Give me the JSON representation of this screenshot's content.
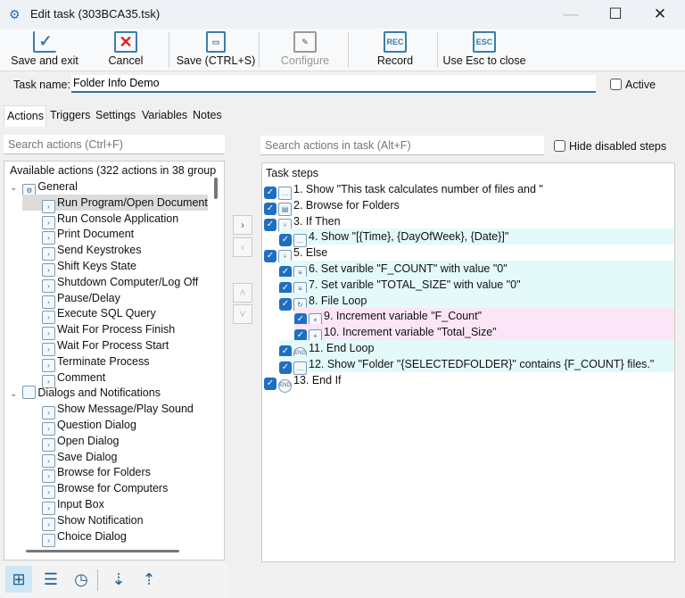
{
  "window": {
    "title": "Edit task (303BCA35.tsk)",
    "minimize": "—",
    "maximize": "☐",
    "close": "✕"
  },
  "toolbar": {
    "save_exit": "Save and exit",
    "cancel": "Cancel",
    "save": "Save (CTRL+S)",
    "configure": "Configure",
    "record": "Record",
    "esc": "Use Esc to close",
    "rec_icon": "REC",
    "esc_icon": "ESC"
  },
  "task_name": {
    "label": "Task name:",
    "value": "Folder Info Demo",
    "active_label": "Active"
  },
  "tabs": [
    "Actions",
    "Triggers",
    "Settings",
    "Variables",
    "Notes"
  ],
  "left": {
    "search_placeholder": "Search actions (Ctrl+F)",
    "header": "Available actions (322 actions in 38 group",
    "groups": [
      {
        "name": "General",
        "items": [
          "Run Program/Open Document",
          "Run Console Application",
          "Print Document",
          "Send Keystrokes",
          "Shift Keys State",
          "Shutdown Computer/Log Off",
          "Pause/Delay",
          "Execute SQL Query",
          "Wait For Process Finish",
          "Wait For Process Start",
          "Terminate Process",
          "Comment"
        ]
      },
      {
        "name": "Dialogs and Notifications",
        "items": [
          "Show Message/Play Sound",
          "Question Dialog",
          "Open Dialog",
          "Save Dialog",
          "Browse for Folders",
          "Browse for Computers",
          "Input Box",
          "Show Notification",
          "Choice Dialog"
        ]
      }
    ],
    "selected": "Run Program/Open Document"
  },
  "right": {
    "search_placeholder": "Search actions in task (Alt+F)",
    "hide_disabled": "Hide disabled steps",
    "header": "Task steps",
    "steps": [
      {
        "text": "1. Show \"This task calculates number of files and \"",
        "level": 0,
        "icon": "message"
      },
      {
        "text": "2. Browse for Folders",
        "level": 0,
        "icon": "folder-dialog"
      },
      {
        "text": "3. If Then",
        "level": 0,
        "icon": "branch"
      },
      {
        "text": "4. Show \"[{Time}, {DayOfWeek}, {Date}]\"",
        "level": 1,
        "icon": "message"
      },
      {
        "text": "5. Else",
        "level": 0,
        "icon": "branch"
      },
      {
        "text": "6. Set varible \"F_COUNT\" with value \"0\"",
        "level": 1,
        "icon": "variable"
      },
      {
        "text": "7. Set varible \"TOTAL_SIZE\" with value \"0\"",
        "level": 1,
        "icon": "variable"
      },
      {
        "text": "8. File Loop",
        "level": 1,
        "icon": "loop"
      },
      {
        "text": "9. Increment variable \"F_Count\"",
        "level": 2,
        "icon": "increment"
      },
      {
        "text": "10. Increment variable \"Total_Size\"",
        "level": 2,
        "icon": "increment"
      },
      {
        "text": "11. End Loop",
        "level": 1,
        "icon": "end"
      },
      {
        "text": "12. Show \"Folder \"{SELECTEDFOLDER}\" contains {F_COUNT} files.\"",
        "level": 1,
        "icon": "message"
      },
      {
        "text": "13. End If",
        "level": 0,
        "icon": "end"
      }
    ]
  },
  "colors": {
    "level1": "#e4f9f9",
    "level2": "#fbe5f7",
    "check": "#1f6fc0"
  }
}
